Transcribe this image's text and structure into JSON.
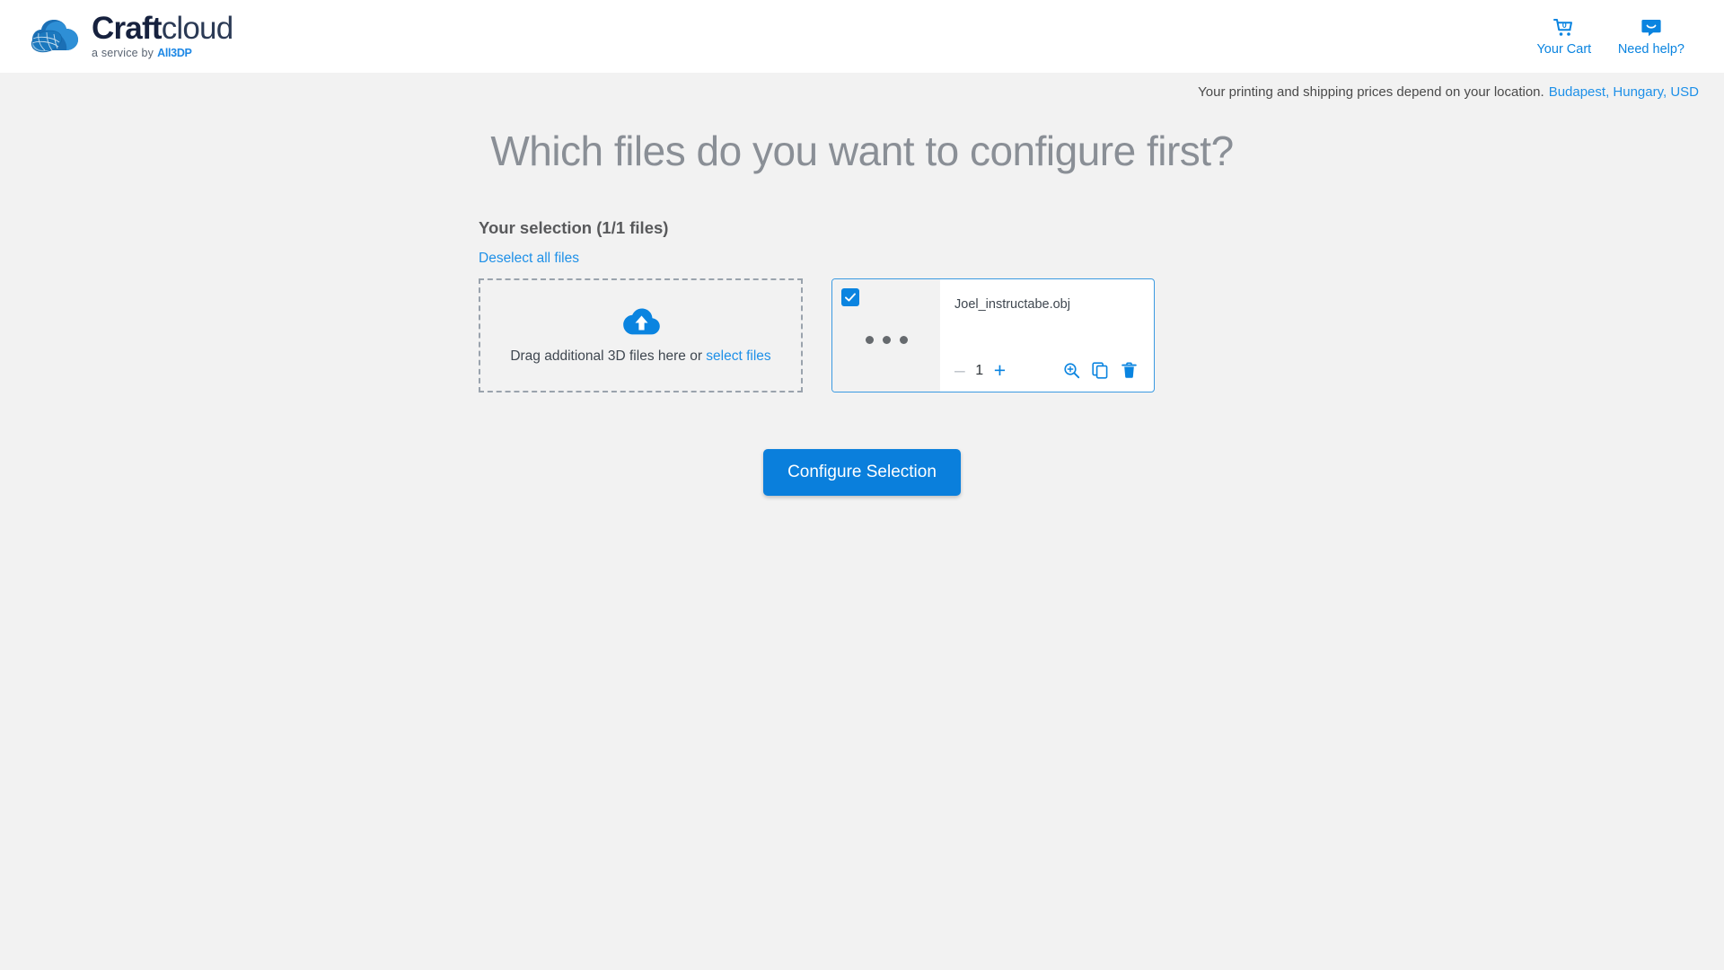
{
  "header": {
    "logo": {
      "name_bold": "Craft",
      "name_light": "cloud",
      "tagline_prefix": "a service by",
      "tagline_brand": "All3DP",
      "icon": "craftcloud-cloud-globe-logo"
    },
    "actions": [
      {
        "icon": "shopping-cart-icon",
        "badge": "0",
        "label": "Your Cart"
      },
      {
        "icon": "chat-bubble-icon",
        "label": "Need help?"
      }
    ]
  },
  "location_bar": {
    "text": "Your printing and shipping prices depend on your location.",
    "link": "Budapest, Hungary, USD"
  },
  "main": {
    "title": "Which files do you want to configure first?",
    "selection_heading": "Your selection (1/1 files)",
    "deselect_link": "Deselect all files",
    "dropzone": {
      "icon": "cloud-upload-icon",
      "text": "Drag additional 3D files here or",
      "link": "select files"
    },
    "file_card": {
      "checkbox_checked": true,
      "thumbnail_state": "loading-dots",
      "name": "Joel_instructabe.obj",
      "quantity": "1",
      "minus_label": "–",
      "plus_label": "+",
      "icons": [
        {
          "name": "zoom-in-icon",
          "title": "Preview model"
        },
        {
          "name": "duplicate-icon",
          "title": "Duplicate file"
        },
        {
          "name": "delete-icon",
          "title": "Delete file"
        }
      ]
    },
    "cta_label": "Configure Selection"
  },
  "colors": {
    "accent_blue": "#0a84e0",
    "cta_blue": "#0a7fdc",
    "link_blue": "#1e90e8",
    "page_bg": "#f2f2f2",
    "title_gray": "#8a8f96"
  }
}
